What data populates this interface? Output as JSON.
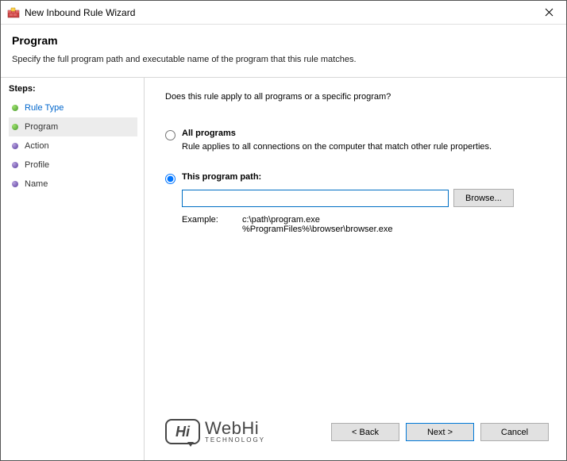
{
  "titlebar": {
    "title": "New Inbound Rule Wizard"
  },
  "header": {
    "heading": "Program",
    "description": "Specify the full program path and executable name of the program that this rule matches."
  },
  "sidebar": {
    "label": "Steps:",
    "items": [
      {
        "label": "Rule Type"
      },
      {
        "label": "Program"
      },
      {
        "label": "Action"
      },
      {
        "label": "Profile"
      },
      {
        "label": "Name"
      }
    ]
  },
  "content": {
    "question": "Does this rule apply to all programs or a specific program?",
    "opt_all": {
      "label": "All programs",
      "desc": "Rule applies to all connections on the computer that match other rule properties."
    },
    "opt_path": {
      "label": "This program path:",
      "value": "",
      "browse": "Browse...",
      "example_label": "Example:",
      "example_paths": "c:\\path\\program.exe\n%ProgramFiles%\\browser\\browser.exe"
    }
  },
  "footer": {
    "back": "< Back",
    "next": "Next >",
    "cancel": "Cancel"
  },
  "watermark": {
    "badge": "Hi",
    "main": "WebHi",
    "sub": "TECHNOLOGY"
  }
}
